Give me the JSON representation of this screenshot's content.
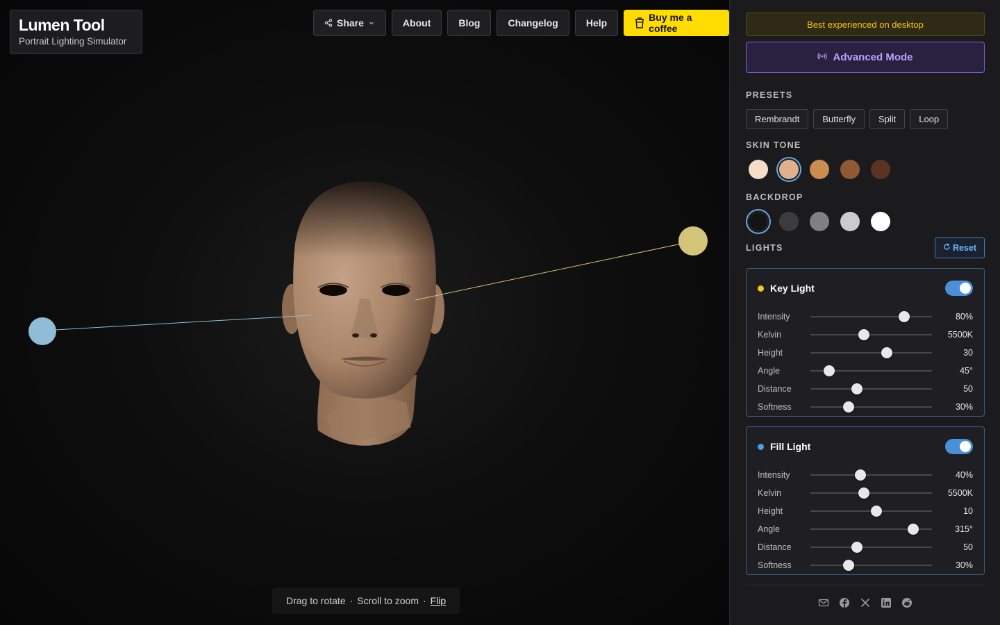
{
  "brand": {
    "title": "Lumen Tool",
    "subtitle": "Portrait Lighting Simulator"
  },
  "nav": {
    "share_label": "Share",
    "about_label": "About",
    "blog_label": "Blog",
    "changelog_label": "Changelog",
    "help_label": "Help",
    "coffee_label": "Buy me a coffee"
  },
  "hint": {
    "rotate": "Drag to rotate",
    "sep1": "·",
    "zoom": "Scroll to zoom",
    "sep2": "·",
    "flip": "Flip"
  },
  "panel": {
    "desktop_notice": "Best experienced on desktop",
    "advanced_label": "Advanced Mode",
    "presets_heading": "PRESETS",
    "presets": [
      "Rembrandt",
      "Butterfly",
      "Split",
      "Loop"
    ],
    "skin_heading": "SKIN TONE",
    "skin_tones": [
      "#f5dcc6",
      "#e0b08e",
      "#c98d52",
      "#8f5934",
      "#5a3420"
    ],
    "skin_selected": 1,
    "backdrop_heading": "BACKDROP",
    "backdrops": [
      "#141414",
      "#3c3c3c",
      "#808080",
      "#cccccc",
      "#ffffff"
    ],
    "backdrop_selected": 0,
    "lights_heading": "LIGHTS",
    "reset_label": "Reset"
  },
  "key_light": {
    "title": "Key Light",
    "color": "#f5c518",
    "enabled": true,
    "params": [
      {
        "label": "Intensity",
        "value": "80%",
        "fraction": 0.77
      },
      {
        "label": "Kelvin",
        "value": "5500K",
        "fraction": 0.44
      },
      {
        "label": "Height",
        "value": "30",
        "fraction": 0.63
      },
      {
        "label": "Angle",
        "value": "45°",
        "fraction": 0.155
      },
      {
        "label": "Distance",
        "value": "50",
        "fraction": 0.385
      },
      {
        "label": "Softness",
        "value": "30%",
        "fraction": 0.315
      }
    ]
  },
  "fill_light": {
    "title": "Fill Light",
    "color": "#4a9fe8",
    "enabled": true,
    "params": [
      {
        "label": "Intensity",
        "value": "40%",
        "fraction": 0.41
      },
      {
        "label": "Kelvin",
        "value": "5500K",
        "fraction": 0.44
      },
      {
        "label": "Height",
        "value": "10",
        "fraction": 0.545
      },
      {
        "label": "Angle",
        "value": "315°",
        "fraction": 0.845
      },
      {
        "label": "Distance",
        "value": "50",
        "fraction": 0.385
      },
      {
        "label": "Softness",
        "value": "30%",
        "fraction": 0.315
      }
    ]
  },
  "social_icons": [
    "mail-icon",
    "facebook-icon",
    "x-icon",
    "linkedin-icon",
    "reddit-icon"
  ],
  "scene": {
    "key_light_color": "#d4c47a",
    "fill_light_color": "#8fbcd6",
    "skin_color": "#b08c72"
  }
}
